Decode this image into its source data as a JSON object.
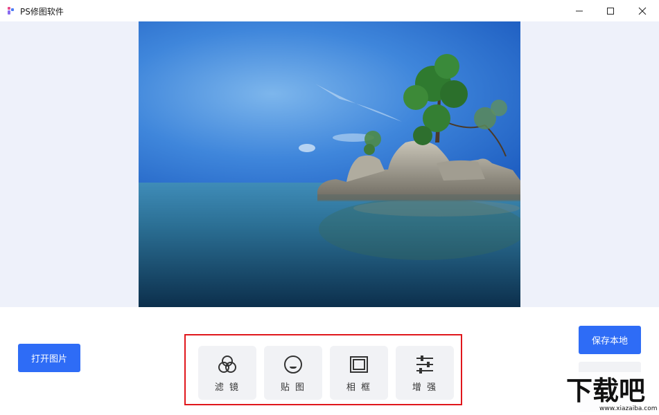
{
  "window": {
    "title": "PS修图软件",
    "minimize_icon": "minimize-icon",
    "maximize_icon": "maximize-icon",
    "close_icon": "close-icon"
  },
  "colors": {
    "primary": "#2e6cf6",
    "canvas_bg": "#eef1fa",
    "highlight_border": "#e0161b",
    "tool_bg": "#f1f2f5"
  },
  "actions": {
    "open_image": "打开图片",
    "save_local": "保存本地"
  },
  "tools": [
    {
      "label": "滤 镜",
      "icon": "filter-icon"
    },
    {
      "label": "贴 图",
      "icon": "sticker-icon"
    },
    {
      "label": "相 框",
      "icon": "frame-icon"
    },
    {
      "label": "增 强",
      "icon": "adjust-sliders-icon"
    }
  ],
  "watermark": {
    "text": "下载吧",
    "url": "www.xiazaiba.com"
  }
}
